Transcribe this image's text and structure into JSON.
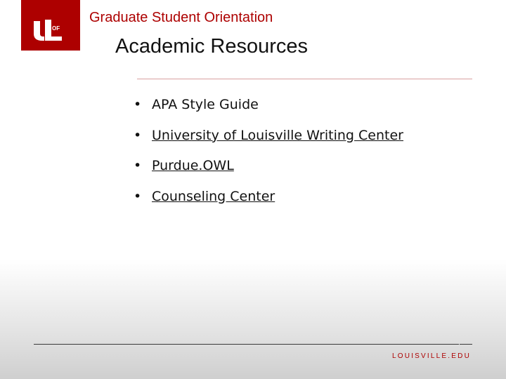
{
  "logo": {
    "text": "UofL",
    "background_color": "#ad0000"
  },
  "header": {
    "text": "Graduate Student Orientation"
  },
  "title": "Academic Resources",
  "bullets": [
    {
      "label": "APA Style Guide",
      "link": false
    },
    {
      "label": "University of Louisville Writing Center",
      "link": true
    },
    {
      "label": "Purdue.OWL",
      "link": true
    },
    {
      "label": "Counseling Center",
      "link": true
    }
  ],
  "footer": {
    "text": "LOUISVILLE.EDU"
  },
  "colors": {
    "accent": "#ad0000",
    "text": "#111111"
  }
}
